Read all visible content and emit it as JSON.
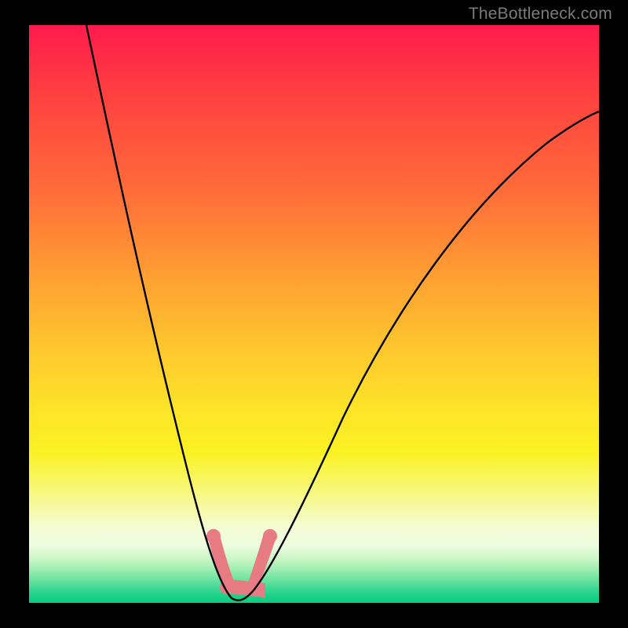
{
  "watermark": "TheBottleneck.com",
  "chart_data": {
    "type": "line",
    "title": "",
    "xlabel": "",
    "ylabel": "",
    "xlim": [
      0,
      100
    ],
    "ylim": [
      0,
      100
    ],
    "series": [
      {
        "name": "bottleneck-curve",
        "x": [
          10,
          14,
          18,
          22,
          25,
          28,
          30,
          32,
          33.5,
          35,
          37,
          40,
          45,
          50,
          56,
          63,
          72,
          82,
          92,
          100
        ],
        "values": [
          100,
          83,
          66,
          50,
          36,
          22,
          12,
          5,
          1,
          0,
          0.5,
          3,
          10,
          20,
          33,
          46,
          59,
          70,
          78,
          84
        ]
      }
    ],
    "annotations": [
      {
        "name": "pink-band",
        "x_range": [
          31.5,
          38.5
        ],
        "y_range": [
          0,
          11
        ]
      }
    ],
    "background_gradient": {
      "top": "#ff1a4d",
      "mid": "#fde328",
      "bottom": "#07cd81"
    }
  }
}
